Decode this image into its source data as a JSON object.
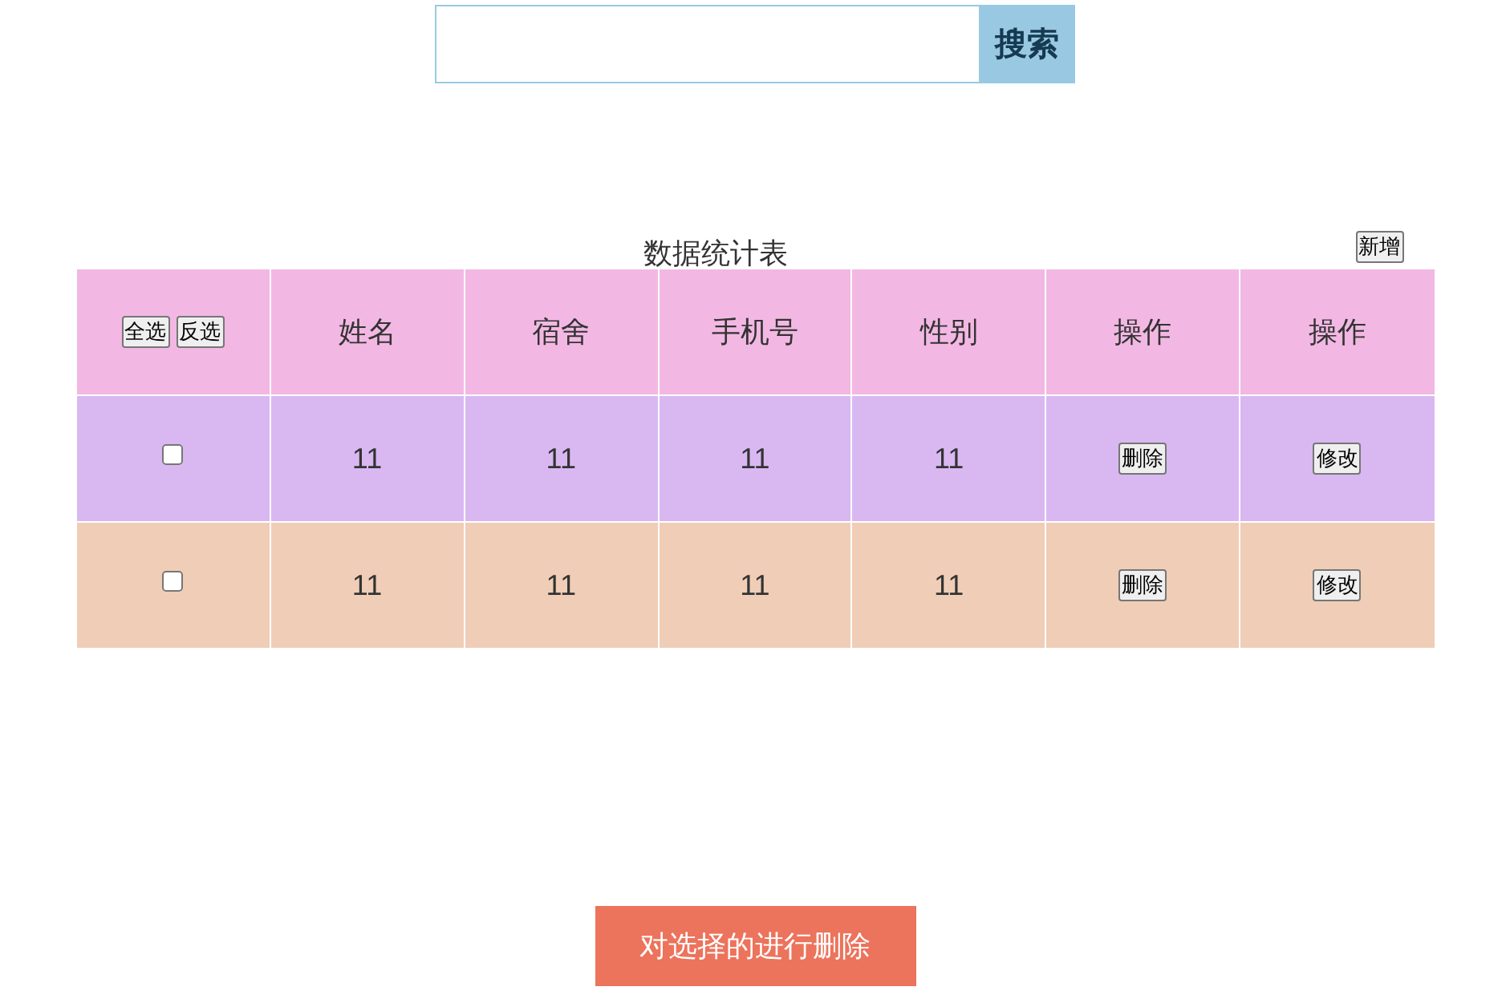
{
  "search": {
    "button": "搜索"
  },
  "table": {
    "caption": "数据统计表",
    "add_button": "新增",
    "header": {
      "color": "#f2b8e3",
      "select_all": "全选",
      "invert_selection": "反选",
      "columns": [
        "姓名",
        "宿舍",
        "手机号",
        "性别",
        "操作",
        "操作"
      ]
    },
    "rows": [
      {
        "color": "#d9b8f2",
        "checked": false,
        "cells": [
          "11",
          "11",
          "11",
          "11"
        ],
        "actions": [
          "删除",
          "修改"
        ]
      },
      {
        "color": "#f0cdb6",
        "checked": false,
        "cells": [
          "11",
          "11",
          "11",
          "11"
        ],
        "actions": [
          "删除",
          "修改"
        ]
      }
    ]
  },
  "delete_selected_button": "对选择的进行删除"
}
